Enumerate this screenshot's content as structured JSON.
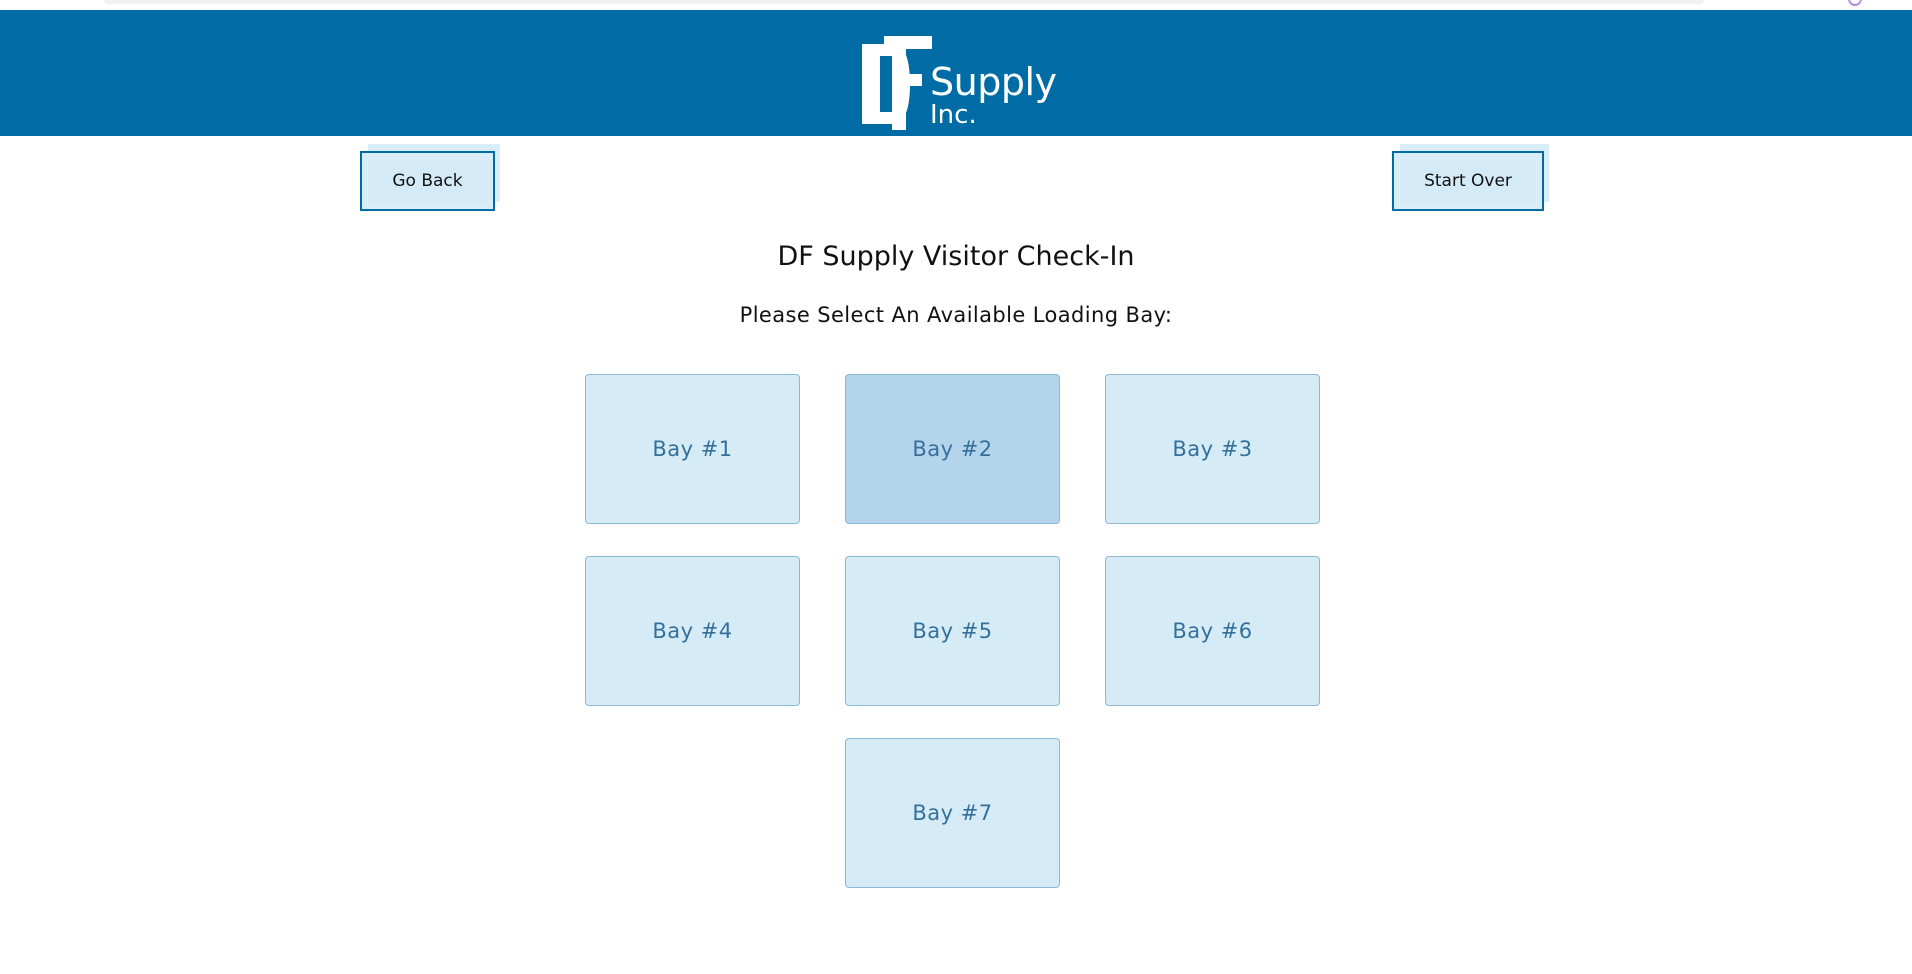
{
  "colors": {
    "brand": "#006ca5",
    "tile_bg": "#d5ecf7",
    "tile_selected_bg": "#b3d4ea",
    "tile_text": "#35709a"
  },
  "header": {
    "logo_mark": "DF",
    "logo_line1": "Supply",
    "logo_line2": "Inc."
  },
  "nav": {
    "back_label": "Go Back",
    "start_over_label": "Start Over"
  },
  "page": {
    "title": "DF Supply Visitor Check-In",
    "subtitle": "Please Select An Available Loading Bay:"
  },
  "bays": [
    {
      "label": "Bay #1",
      "selected": false
    },
    {
      "label": "Bay #2",
      "selected": true
    },
    {
      "label": "Bay #3",
      "selected": false
    },
    {
      "label": "Bay #4",
      "selected": false
    },
    {
      "label": "Bay #5",
      "selected": false
    },
    {
      "label": "Bay #6",
      "selected": false
    },
    {
      "label": "Bay #7",
      "selected": false
    }
  ]
}
